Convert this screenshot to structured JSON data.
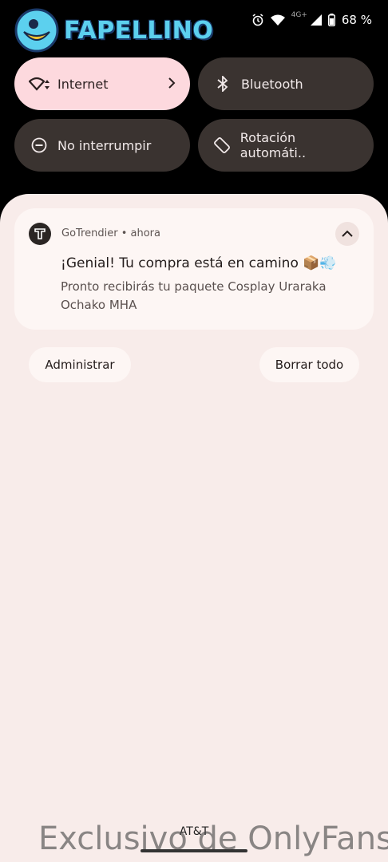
{
  "logo": {
    "text": "FAPELLINO"
  },
  "status_bar": {
    "network_type": "4G+",
    "battery_percent": "68 %",
    "icons": [
      "alarm-icon",
      "wifi-icon",
      "signal-icon",
      "battery-icon"
    ]
  },
  "quick_settings": {
    "tiles": [
      {
        "label": "Internet",
        "icon": "wifi-icon",
        "active": true,
        "has_chevron": true
      },
      {
        "label": "Bluetooth",
        "icon": "bluetooth-icon",
        "active": false
      },
      {
        "label": "No interrumpir",
        "icon": "do-not-disturb-icon",
        "active": false
      },
      {
        "label": "Rotación automáti..",
        "icon": "auto-rotate-icon",
        "active": false
      }
    ]
  },
  "notification": {
    "app_name": "GoTrendier",
    "separator": "•",
    "time": "ahora",
    "title": "¡Genial! Tu compra está en camino  📦💨",
    "body": "Pronto recibirás tu paquete Cosplay Uraraka Ochako MHA"
  },
  "actions": {
    "manage_label": "Administrar",
    "clear_all_label": "Borrar todo"
  },
  "carrier": "AT&T",
  "watermark": "Exclusivo de OnlyFans",
  "colors": {
    "background": "#000000",
    "tile_dark": "#3a3330",
    "tile_active": "#fdd9de",
    "shade": "#f8ecea",
    "card": "#fdf6f4",
    "logo": "#5cd0ee"
  }
}
